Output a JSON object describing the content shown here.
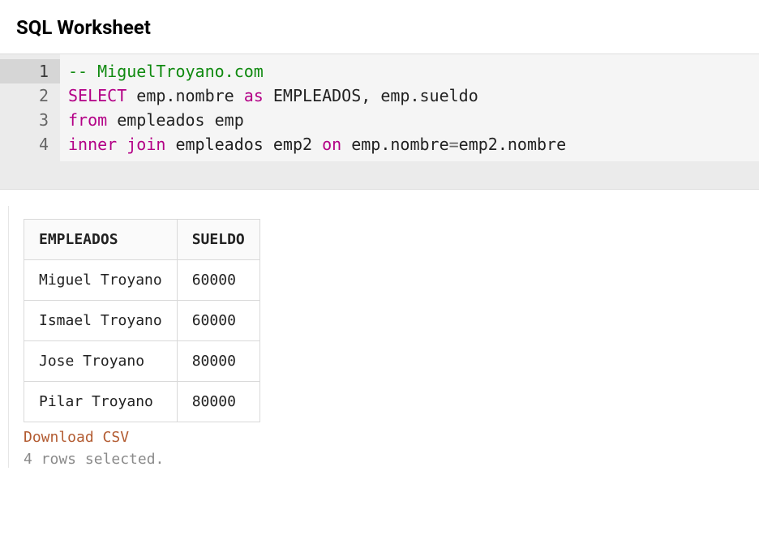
{
  "header": {
    "title": "SQL Worksheet"
  },
  "editor": {
    "active_line": 1,
    "lines": [
      {
        "num": "1",
        "tokens": [
          {
            "cls": "tok-comment",
            "text": "-- MiguelTroyano.com"
          }
        ]
      },
      {
        "num": "2",
        "tokens": [
          {
            "cls": "tok-keyword",
            "text": "SELECT"
          },
          {
            "cls": "tok-ident",
            "text": " emp.nombre "
          },
          {
            "cls": "tok-as",
            "text": "as"
          },
          {
            "cls": "tok-ident",
            "text": " EMPLEADOS, emp.sueldo"
          }
        ]
      },
      {
        "num": "3",
        "tokens": [
          {
            "cls": "tok-keyword",
            "text": "from"
          },
          {
            "cls": "tok-ident",
            "text": " empleados emp"
          }
        ]
      },
      {
        "num": "4",
        "tokens": [
          {
            "cls": "tok-keyword",
            "text": "inner join"
          },
          {
            "cls": "tok-ident",
            "text": " empleados emp2 "
          },
          {
            "cls": "tok-keyword",
            "text": "on"
          },
          {
            "cls": "tok-ident",
            "text": " emp.nombre"
          },
          {
            "cls": "tok-op",
            "text": "="
          },
          {
            "cls": "tok-ident",
            "text": "emp2.nombre"
          }
        ]
      }
    ]
  },
  "results": {
    "columns": [
      "EMPLEADOS",
      "SUELDO"
    ],
    "rows": [
      [
        "Miguel Troyano",
        "60000"
      ],
      [
        "Ismael Troyano",
        "60000"
      ],
      [
        "Jose Troyano",
        "80000"
      ],
      [
        "Pilar Troyano",
        "80000"
      ]
    ],
    "download_label": "Download CSV",
    "status": "4 rows selected."
  }
}
